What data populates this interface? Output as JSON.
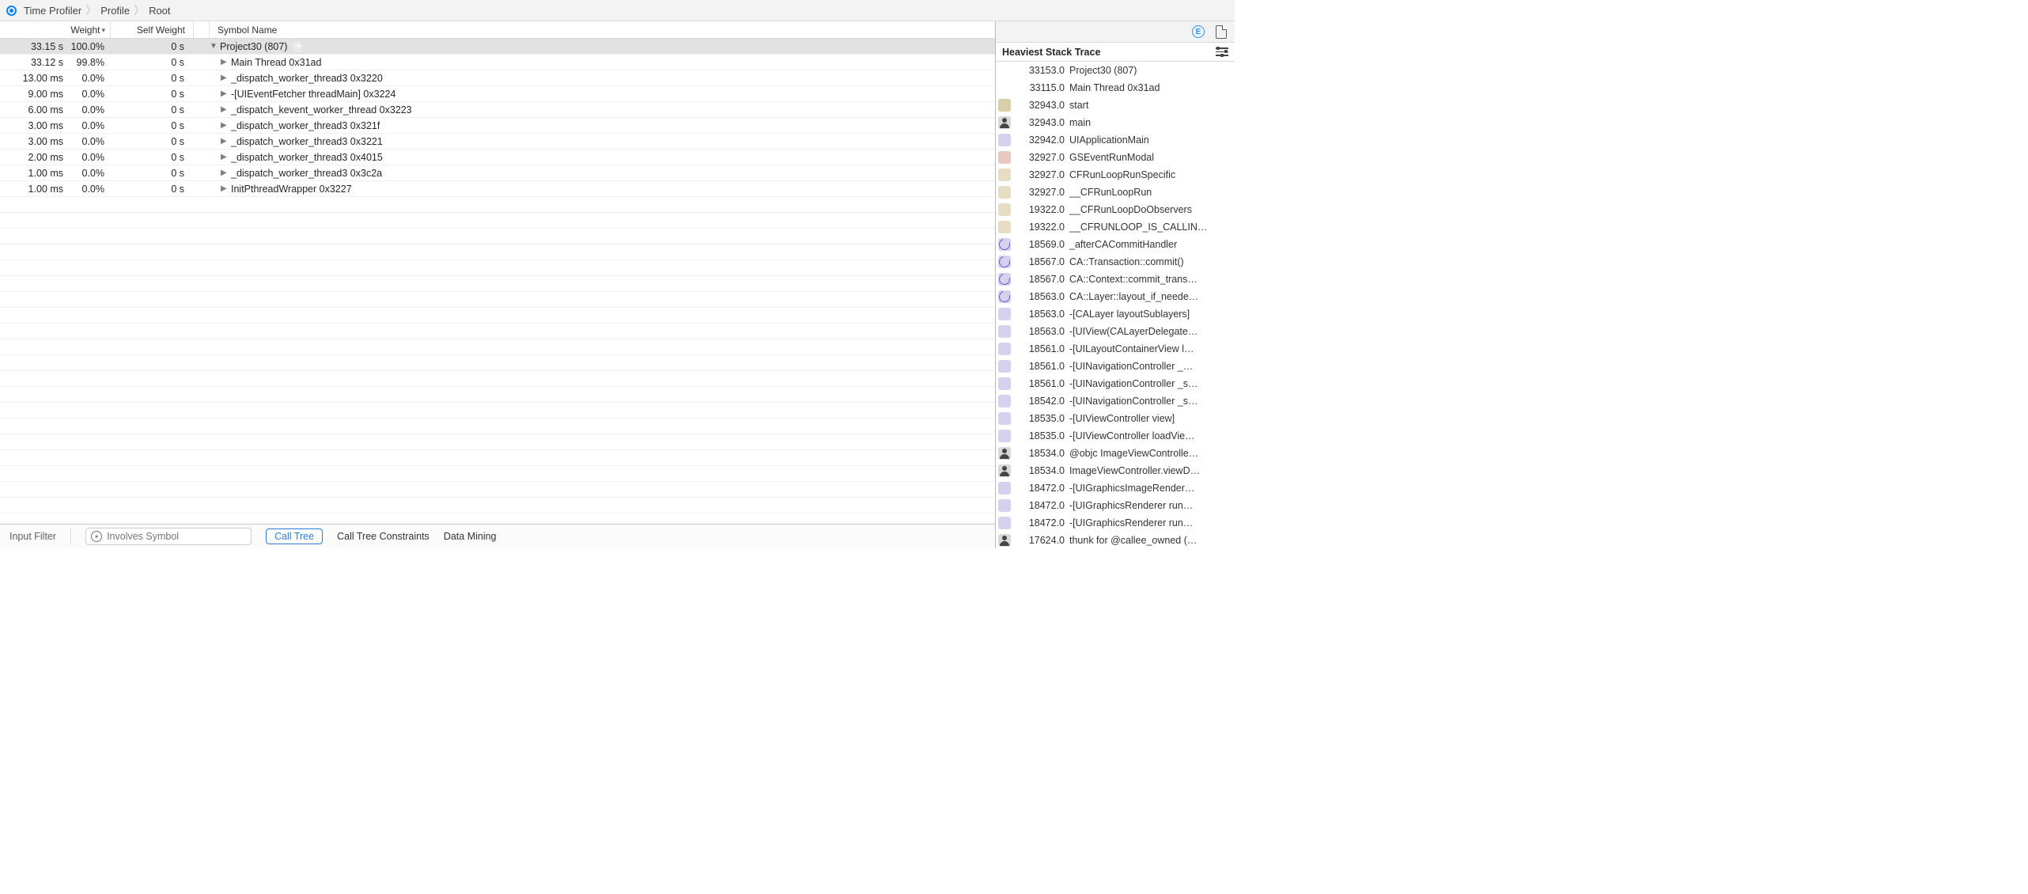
{
  "breadcrumb": {
    "a": "Time Profiler",
    "b": "Profile",
    "c": "Root"
  },
  "topright": {
    "e_label": "E"
  },
  "columns": {
    "weight": "Weight",
    "self": "Self Weight",
    "symbol": "Symbol Name"
  },
  "rows": [
    {
      "time": "33.15 s",
      "pct": "100.0%",
      "self": "0 s",
      "indent": 0,
      "open": true,
      "sym": "Project30 (807)"
    },
    {
      "time": "33.12 s",
      "pct": "99.8%",
      "self": "0 s",
      "indent": 1,
      "open": false,
      "sym": "Main Thread  0x31ad"
    },
    {
      "time": "13.00 ms",
      "pct": "0.0%",
      "self": "0 s",
      "indent": 1,
      "open": false,
      "sym": "_dispatch_worker_thread3  0x3220"
    },
    {
      "time": "9.00 ms",
      "pct": "0.0%",
      "self": "0 s",
      "indent": 1,
      "open": false,
      "sym": "-[UIEventFetcher threadMain]  0x3224"
    },
    {
      "time": "6.00 ms",
      "pct": "0.0%",
      "self": "0 s",
      "indent": 1,
      "open": false,
      "sym": "_dispatch_kevent_worker_thread  0x3223"
    },
    {
      "time": "3.00 ms",
      "pct": "0.0%",
      "self": "0 s",
      "indent": 1,
      "open": false,
      "sym": "_dispatch_worker_thread3  0x321f"
    },
    {
      "time": "3.00 ms",
      "pct": "0.0%",
      "self": "0 s",
      "indent": 1,
      "open": false,
      "sym": "_dispatch_worker_thread3  0x3221"
    },
    {
      "time": "2.00 ms",
      "pct": "0.0%",
      "self": "0 s",
      "indent": 1,
      "open": false,
      "sym": "_dispatch_worker_thread3  0x4015"
    },
    {
      "time": "1.00 ms",
      "pct": "0.0%",
      "self": "0 s",
      "indent": 1,
      "open": false,
      "sym": "_dispatch_worker_thread3  0x3c2a"
    },
    {
      "time": "1.00 ms",
      "pct": "0.0%",
      "self": "0 s",
      "indent": 1,
      "open": false,
      "sym": "InitPthreadWrapper  0x3227"
    }
  ],
  "bottom": {
    "input_filter": "Input Filter",
    "involves_placeholder": "Involves Symbol",
    "call_tree": "Call Tree",
    "constraints": "Call Tree Constraints",
    "data_mining": "Data Mining"
  },
  "right": {
    "title": "Heaviest Stack Trace",
    "rows": [
      {
        "icon": "none",
        "val": "33153.0",
        "name": "Project30 (807)"
      },
      {
        "icon": "none",
        "val": "33115.0",
        "name": "Main Thread  0x31ad"
      },
      {
        "icon": "gear",
        "val": "32943.0",
        "name": "start"
      },
      {
        "icon": "person",
        "val": "32943.0",
        "name": "main"
      },
      {
        "icon": "mug-purple",
        "val": "32942.0",
        "name": "UIApplicationMain"
      },
      {
        "icon": "briefcase",
        "val": "32927.0",
        "name": "GSEventRunModal"
      },
      {
        "icon": "mug-tan",
        "val": "32927.0",
        "name": "CFRunLoopRunSpecific"
      },
      {
        "icon": "mug-tan",
        "val": "32927.0",
        "name": "__CFRunLoopRun"
      },
      {
        "icon": "mug-tan",
        "val": "19322.0",
        "name": "__CFRunLoopDoObservers"
      },
      {
        "icon": "mug-tan",
        "val": "19322.0",
        "name": "__CFRUNLOOP_IS_CALLIN…"
      },
      {
        "icon": "clock",
        "val": "18569.0",
        "name": "_afterCACommitHandler"
      },
      {
        "icon": "clock",
        "val": "18567.0",
        "name": "CA::Transaction::commit()"
      },
      {
        "icon": "clock",
        "val": "18567.0",
        "name": "CA::Context::commit_trans…"
      },
      {
        "icon": "clock",
        "val": "18563.0",
        "name": "CA::Layer::layout_if_neede…"
      },
      {
        "icon": "mug-purple",
        "val": "18563.0",
        "name": "-[CALayer layoutSublayers]"
      },
      {
        "icon": "mug-purple",
        "val": "18563.0",
        "name": "-[UIView(CALayerDelegate…"
      },
      {
        "icon": "mug-purple",
        "val": "18561.0",
        "name": "-[UILayoutContainerView l…"
      },
      {
        "icon": "mug-purple",
        "val": "18561.0",
        "name": "-[UINavigationController _…"
      },
      {
        "icon": "mug-purple",
        "val": "18561.0",
        "name": "-[UINavigationController _s…"
      },
      {
        "icon": "mug-purple",
        "val": "18542.0",
        "name": "-[UINavigationController _s…"
      },
      {
        "icon": "mug-purple",
        "val": "18535.0",
        "name": "-[UIViewController view]"
      },
      {
        "icon": "mug-purple",
        "val": "18535.0",
        "name": "-[UIViewController loadVie…"
      },
      {
        "icon": "person",
        "val": "18534.0",
        "name": "@objc ImageViewControlle…"
      },
      {
        "icon": "person",
        "val": "18534.0",
        "name": "ImageViewController.viewD…"
      },
      {
        "icon": "mug-purple",
        "val": "18472.0",
        "name": "-[UIGraphicsImageRender…"
      },
      {
        "icon": "mug-purple",
        "val": "18472.0",
        "name": "-[UIGraphicsRenderer run…"
      },
      {
        "icon": "mug-purple",
        "val": "18472.0",
        "name": "-[UIGraphicsRenderer run…"
      },
      {
        "icon": "person",
        "val": "17624.0",
        "name": "thunk for @callee_owned (…"
      }
    ]
  }
}
